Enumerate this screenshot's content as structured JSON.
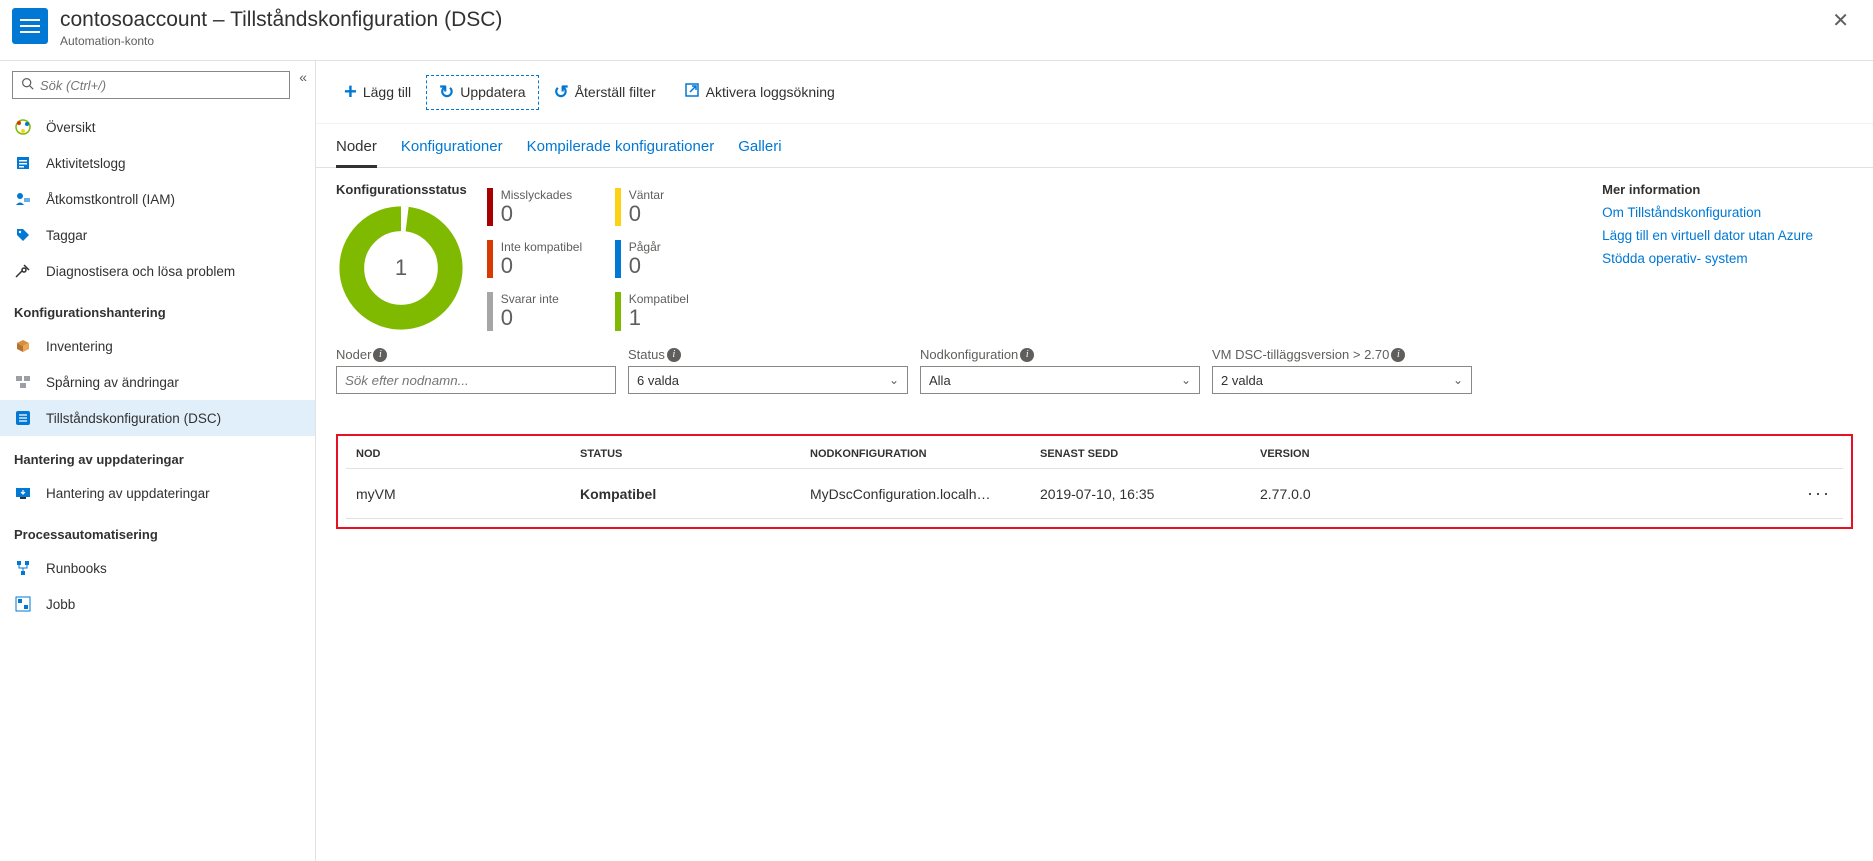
{
  "header": {
    "title": "contosoaccount – Tillståndskonfiguration (DSC)",
    "subtitle": "Automation-konto"
  },
  "search": {
    "placeholder": "Sök (Ctrl+/)"
  },
  "sidebar": {
    "items": [
      {
        "label": "Översikt"
      },
      {
        "label": "Aktivitetslogg"
      },
      {
        "label": "Åtkomstkontroll (IAM)"
      },
      {
        "label": "Taggar"
      },
      {
        "label": "Diagnostisera och lösa problem"
      }
    ],
    "group1": "Konfigurationshantering",
    "config_items": [
      {
        "label": "Inventering"
      },
      {
        "label": "Spårning av ändringar"
      },
      {
        "label": "Tillståndskonfiguration (DSC)"
      }
    ],
    "group2": "Hantering av uppdateringar",
    "update_items": [
      {
        "label": "Hantering av uppdateringar"
      }
    ],
    "group3": "Processautomatisering",
    "process_items": [
      {
        "label": "Runbooks"
      },
      {
        "label": "Jobb"
      }
    ]
  },
  "toolbar": {
    "add": "Lägg till",
    "refresh": "Uppdatera",
    "reset": "Återställ filter",
    "activate": "Aktivera loggsökning"
  },
  "tabs": {
    "nodes": "Noder",
    "configs": "Konfigurationer",
    "compiled": "Kompilerade konfigurationer",
    "gallery": "Galleri"
  },
  "status_title": "Konfigurationsstatus",
  "donut_value": "1",
  "stats": {
    "failed": {
      "label": "Misslyckades",
      "val": "0"
    },
    "waiting": {
      "label": "Väntar",
      "val": "0"
    },
    "notcompat": {
      "label": "Inte kompatibel",
      "val": "0"
    },
    "inprog": {
      "label": "Pågår",
      "val": "0"
    },
    "noresp": {
      "label": "Svarar inte",
      "val": "0"
    },
    "compat": {
      "label": "Kompatibel",
      "val": "1"
    }
  },
  "info": {
    "title": "Mer information",
    "link1": "Om Tillståndskonfiguration",
    "link2": "Lägg till en virtuell dator utan Azure",
    "link3": "Stödda operativ- system"
  },
  "filters": {
    "nodes": {
      "label": "Noder",
      "placeholder": "Sök efter nodnamn..."
    },
    "status": {
      "label": "Status",
      "value": "6 valda"
    },
    "nodeconf": {
      "label": "Nodkonfiguration",
      "value": "Alla"
    },
    "version": {
      "label": "VM DSC-tilläggsversion > 2.70",
      "value": "2 valda"
    }
  },
  "table": {
    "headers": {
      "node": "NOD",
      "status": "STATUS",
      "conf": "NODKONFIGURATION",
      "seen": "SENAST SEDD",
      "ver": "VERSION"
    },
    "rows": [
      {
        "node": "myVM",
        "status": "Kompatibel",
        "conf": "MyDscConfiguration.localh…",
        "seen": "2019-07-10, 16:35",
        "ver": "2.77.0.0"
      }
    ]
  },
  "chart_data": {
    "type": "pie",
    "title": "Konfigurationsstatus",
    "categories": [
      "Misslyckades",
      "Väntar",
      "Inte kompatibel",
      "Pågår",
      "Svarar inte",
      "Kompatibel"
    ],
    "values": [
      0,
      0,
      0,
      0,
      0,
      1
    ],
    "colors": [
      "#a80000",
      "#fcd116",
      "#d83b01",
      "#0078d4",
      "#a6a6a6",
      "#7fba00"
    ]
  }
}
